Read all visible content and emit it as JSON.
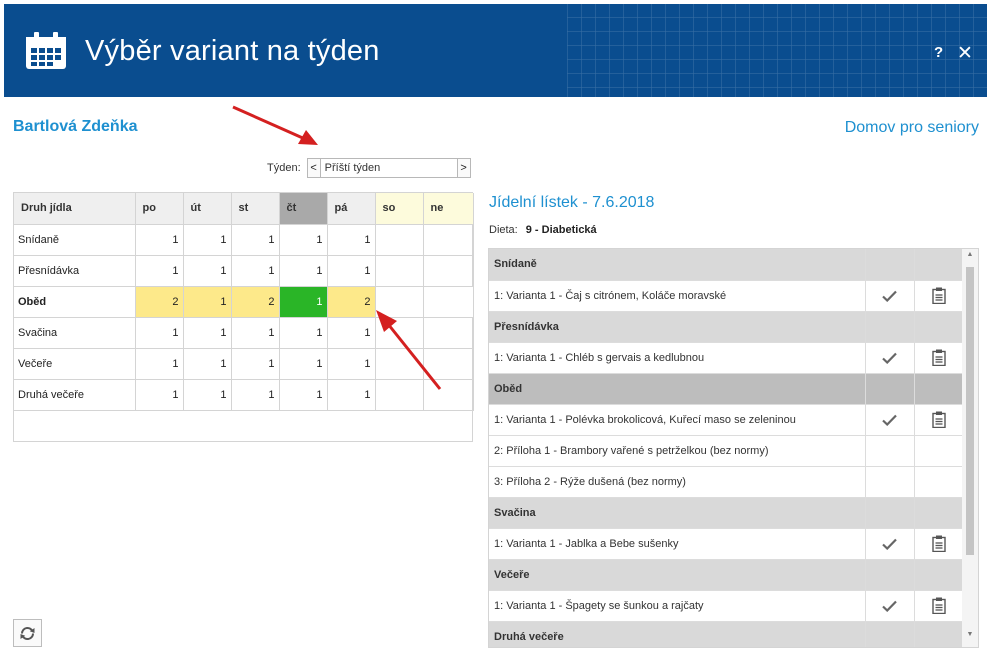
{
  "window": {
    "title": "Výběr variant na týden",
    "help": "?",
    "close": "✕"
  },
  "person": {
    "name": "Bartlová Zdeňka",
    "facility": "Domov pro seniory"
  },
  "week": {
    "label": "Týden:",
    "prev": "<",
    "next": ">",
    "value": "Příští týden"
  },
  "week_table": {
    "headers": [
      "Druh jídla",
      "po",
      "út",
      "st",
      "čt",
      "pá",
      "so",
      "ne"
    ],
    "rows": [
      {
        "name": "Snídaně",
        "values": [
          "1",
          "1",
          "1",
          "1",
          "1",
          "",
          ""
        ]
      },
      {
        "name": "Přesnídávka",
        "values": [
          "1",
          "1",
          "1",
          "1",
          "1",
          "",
          ""
        ]
      },
      {
        "name": "Oběd",
        "values": [
          "2",
          "1",
          "2",
          "1",
          "2",
          "",
          ""
        ]
      },
      {
        "name": "Svačina",
        "values": [
          "1",
          "1",
          "1",
          "1",
          "1",
          "",
          ""
        ]
      },
      {
        "name": "Večeře",
        "values": [
          "1",
          "1",
          "1",
          "1",
          "1",
          "",
          ""
        ]
      },
      {
        "name": "Druhá večeře",
        "values": [
          "1",
          "1",
          "1",
          "1",
          "1",
          "",
          ""
        ]
      }
    ]
  },
  "menu": {
    "title": "Jídelní lístek - 7.6.2018",
    "diet_label": "Dieta:",
    "diet_value": "9 - Diabetická",
    "sections": [
      {
        "name": "Snídaně",
        "items": [
          "1: Varianta 1 - Čaj s citrónem, Koláče moravské"
        ]
      },
      {
        "name": "Přesnídávka",
        "items": [
          "1: Varianta 1 - Chléb s gervais a kedlubnou"
        ]
      },
      {
        "name": "Oběd",
        "items": [
          "1: Varianta 1 - Polévka brokolicová, Kuřecí maso se zeleninou",
          "2: Příloha 1 - Brambory vařené s petrželkou (bez normy)",
          "3: Příloha 2 - Rýže dušená (bez normy)"
        ]
      },
      {
        "name": "Svačina",
        "items": [
          "1: Varianta 1 - Jablka a Bebe sušenky"
        ]
      },
      {
        "name": "Večeře",
        "items": [
          "1: Varianta 1 - Špagety se šunkou a rajčaty"
        ]
      },
      {
        "name": "Druhá večeře",
        "items": []
      }
    ]
  },
  "colors": {
    "header": "#0a4d8f",
    "accent": "#1e90d0",
    "highlight": "#fde98a",
    "today_cell": "#2ab527",
    "arrow": "#d42020"
  },
  "icons": {
    "header": "calendar-icon",
    "refresh": "refresh-icon",
    "check": "check-icon",
    "detail": "clipboard-icon"
  }
}
